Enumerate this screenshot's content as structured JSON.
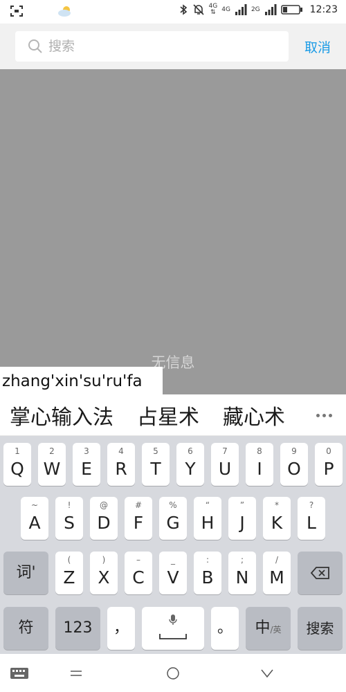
{
  "status_bar": {
    "net_top": "4G",
    "net_mid": "4G",
    "net_2g": "2G",
    "time": "12:23"
  },
  "search": {
    "placeholder": "搜索",
    "cancel_label": "取消"
  },
  "content": {
    "empty_text": "无信息"
  },
  "ime": {
    "composition": "zhang'xin'su'ru'fa",
    "candidates": [
      "掌心输入法",
      "占星术",
      "藏心术"
    ]
  },
  "keyboard": {
    "row1": [
      {
        "hint": "1",
        "key": "Q"
      },
      {
        "hint": "2",
        "key": "W"
      },
      {
        "hint": "3",
        "key": "E"
      },
      {
        "hint": "4",
        "key": "R"
      },
      {
        "hint": "5",
        "key": "T"
      },
      {
        "hint": "6",
        "key": "Y"
      },
      {
        "hint": "7",
        "key": "U"
      },
      {
        "hint": "8",
        "key": "I"
      },
      {
        "hint": "9",
        "key": "O"
      },
      {
        "hint": "0",
        "key": "P"
      }
    ],
    "row2": [
      {
        "hint": "~",
        "key": "A"
      },
      {
        "hint": "!",
        "key": "S"
      },
      {
        "hint": "@",
        "key": "D"
      },
      {
        "hint": "#",
        "key": "F"
      },
      {
        "hint": "%",
        "key": "G"
      },
      {
        "hint": "“",
        "key": "H"
      },
      {
        "hint": "”",
        "key": "J"
      },
      {
        "hint": "*",
        "key": "K"
      },
      {
        "hint": "?",
        "key": "L"
      }
    ],
    "row3_left": "词'",
    "row3": [
      {
        "hint": "(",
        "key": "Z"
      },
      {
        "hint": ")",
        "key": "X"
      },
      {
        "hint": "–",
        "key": "C"
      },
      {
        "hint": "_",
        "key": "V"
      },
      {
        "hint": ":",
        "key": "B"
      },
      {
        "hint": ";",
        "key": "N"
      },
      {
        "hint": "/",
        "key": "M"
      }
    ],
    "symbol_label": "符",
    "number_label": "123",
    "comma_label": "，",
    "period_label": "。",
    "lang_main": "中",
    "lang_sub": "/英",
    "search_label": "搜索"
  },
  "colors": {
    "accent": "#1a9be6",
    "content_bg": "#9a9a9a",
    "keyboard_bg": "#d7d9de"
  }
}
